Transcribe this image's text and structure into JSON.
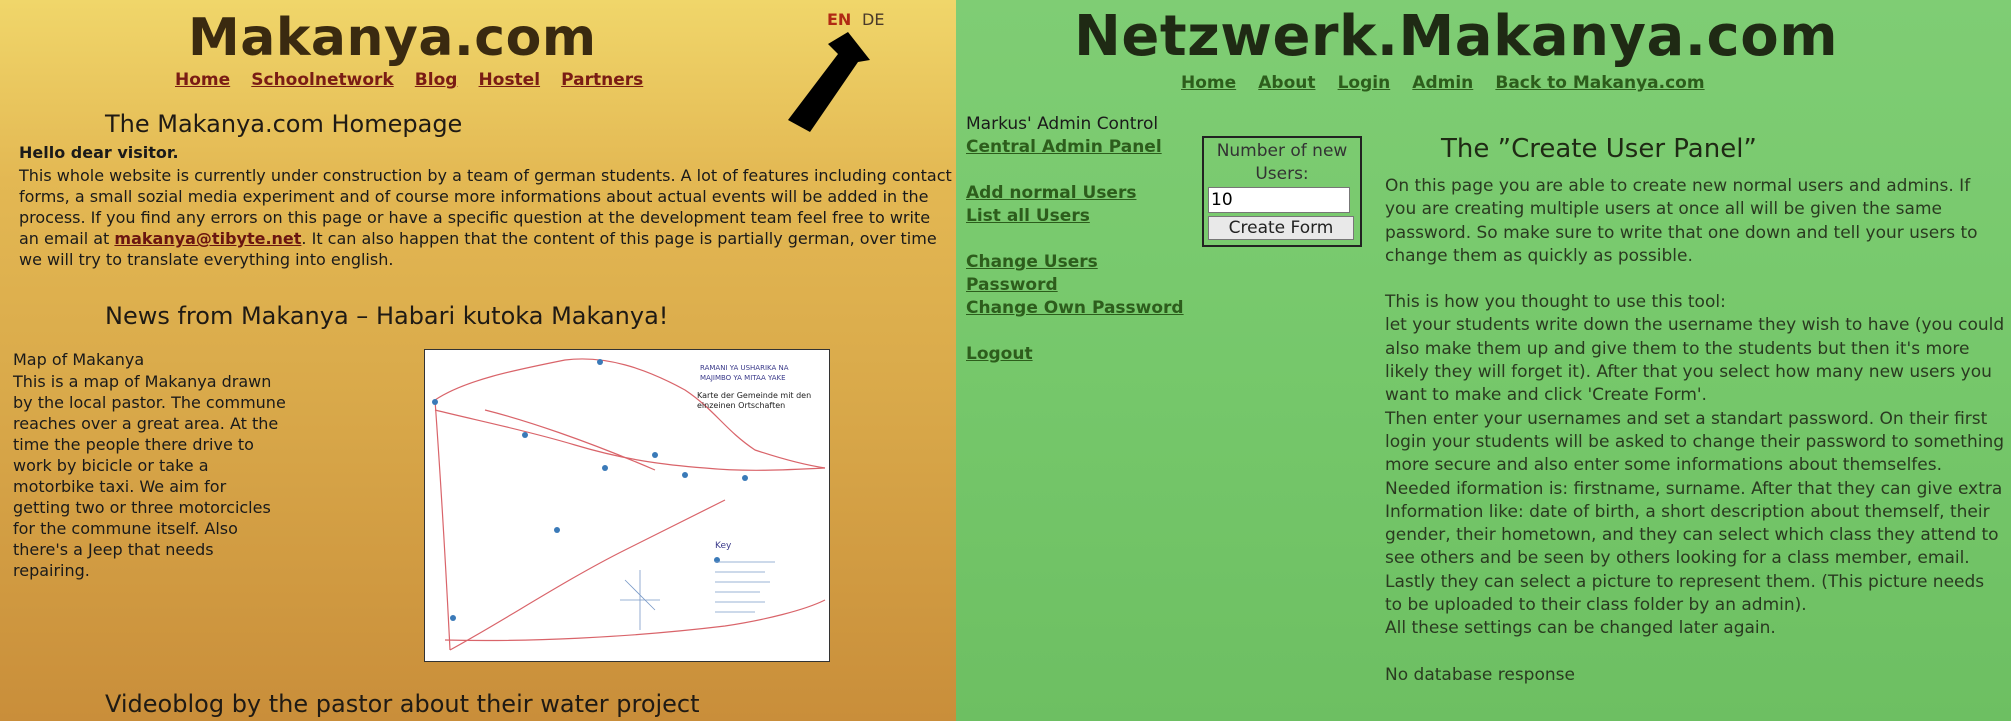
{
  "left": {
    "title": "Makanya.com",
    "nav": [
      "Home",
      "Schoolnetwork",
      "Blog",
      "Hostel",
      "Partners"
    ],
    "lang": {
      "en": "EN",
      "de": "DE"
    },
    "homepage_heading": "The Makanya.com Homepage",
    "greeting": "Hello dear visitor.",
    "intro_before": "This whole website is currently under construction by a team of german students. A lot of features including contact forms, a small sozial media experiment and of course more informations about actual events will be added in the process. If you find any errors on this page or have a specific question at the development team feel free to write an email at ",
    "intro_email": "makanya@tibyte.net",
    "intro_after": ". It can also happen that the content of this page is partially german, over time we will try to translate everything into english.",
    "news_heading": "News from Makanya – Habari kutoka Makanya!",
    "map_title": "Map of Makanya",
    "map_text": "This is a map of Makanya drawn by the local pastor. The commune reaches over a great area. At the time the people there drive to work by bicicle or take a motorbike taxi. We aim for getting two or three motorcicles for the commune itself. Also there's a Jeep that needs repairing.",
    "map_image": {
      "printed_label_1": "Karte der Gemeinde mit den",
      "printed_label_2": "einzeinen Ortschaften",
      "handwritten_1": "RAMANI YA USHARIKA NA",
      "handwritten_2": "MAJIMBO YA MITAA YAKE",
      "key": "Key"
    },
    "video_heading": "Videoblog by the pastor about their water project"
  },
  "right": {
    "title": "Netzwerk.Makanya.com",
    "nav": [
      "Home",
      "About",
      "Login",
      "Admin",
      "Back to Makanya.com"
    ],
    "admin_title": "Markus' Admin Control",
    "links": {
      "central": "Central Admin Panel",
      "add": "Add normal Users",
      "list": "List all Users",
      "change1": "Change Users",
      "change2": "Password",
      "own": "Change Own Password",
      "logout": "Logout"
    },
    "form": {
      "label": "Number of new Users:",
      "value": "10",
      "button": "Create Form"
    },
    "panel_heading": "The ”Create User Panel”",
    "p1": "On this page you are able to create new normal users and admins. If you are creating multiple users at once all will be given the same password. So make sure to write that one down and tell your users to change them as quickly as possible.",
    "p2": "This is how you thought to use this tool:",
    "p3": "let your students write down the username they wish to have (you could also make them up and give them to the students but then it's more likely they will forget it). After that you select how many new users you want to make and click 'Create Form'.",
    "p4": "Then enter your usernames and set a standart password. On their first login your students will be asked to change their password to something more secure and also enter some informations about themselfes. Needed iformation is: firstname, surname. After that they can give extra Information like: date of birth, a short description about themself, their gender, their hometown, and they can select which class they attend to see others and be seen by others looking for a class member, email. Lastly they can select a picture to represent them. (This picture needs to be uploaded to their class folder by an admin).",
    "p5": "All these settings can be changed later again.",
    "p6": "No database response"
  },
  "colors": {
    "left_bg": "#e3b853",
    "right_bg": "#76c86b",
    "left_link": "#7a1c14",
    "right_link": "#2d5d1c",
    "lang_active": "#b02a14"
  }
}
